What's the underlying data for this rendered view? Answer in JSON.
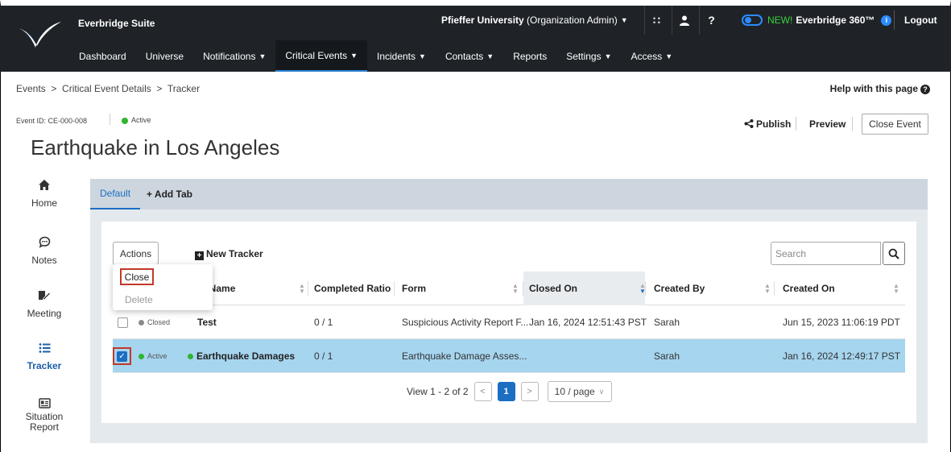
{
  "app": {
    "suite_name": "Everbridge Suite",
    "org_name": "Pfieffer University",
    "org_role": "(Organization Admin)",
    "new_label": "NEW!",
    "new_product": "Everbridge 360™",
    "logout": "Logout"
  },
  "nav": {
    "items": [
      {
        "label": "Dashboard"
      },
      {
        "label": "Universe"
      },
      {
        "label": "Notifications"
      },
      {
        "label": "Critical Events"
      },
      {
        "label": "Incidents"
      },
      {
        "label": "Contacts"
      },
      {
        "label": "Reports"
      },
      {
        "label": "Settings"
      },
      {
        "label": "Access"
      }
    ]
  },
  "breadcrumb": "Events  >  Critical Event Details  >  Tracker",
  "help": "Help with this page",
  "event": {
    "id": "Event ID: CE-000-008",
    "status": "Active",
    "title": "Earthquake in Los Angeles",
    "publish": "Publish",
    "preview": "Preview",
    "close_event": "Close Event"
  },
  "sidebar": {
    "items": [
      {
        "label": "Home"
      },
      {
        "label": "Notes"
      },
      {
        "label": "Meeting"
      },
      {
        "label": "Tracker"
      },
      {
        "label": "Situation Report"
      }
    ]
  },
  "tabs": {
    "default": "Default",
    "add": "+ Add Tab"
  },
  "toolbar": {
    "actions": "Actions",
    "new_tracker": "New Tracker",
    "search_placeholder": "Search"
  },
  "dropdown": {
    "close": "Close",
    "delete": "Delete"
  },
  "table": {
    "headers": {
      "name": "er Name",
      "completed": "Completed Ratio",
      "form": "Form",
      "closed_on": "Closed On",
      "created_by": "Created By",
      "created_on": "Created On"
    },
    "rows": [
      {
        "status": "Closed",
        "name": "Test",
        "ratio": "0 / 1",
        "form": "Suspicious Activity Report F...",
        "closed_on": "Jan 16, 2024 12:51:43 PST",
        "created_by": "Sarah",
        "created_on": "Jun 15, 2023 11:06:19 PDT"
      },
      {
        "status": "Active",
        "name": "Earthquake Damages",
        "ratio": "0 / 1",
        "form": "Earthquake Damage Asses...",
        "closed_on": "",
        "created_by": "Sarah",
        "created_on": "Jan 16, 2024 12:49:17 PST"
      }
    ]
  },
  "pager": {
    "summary": "View 1 - 2 of 2",
    "page": "1",
    "size": "10 / page"
  }
}
